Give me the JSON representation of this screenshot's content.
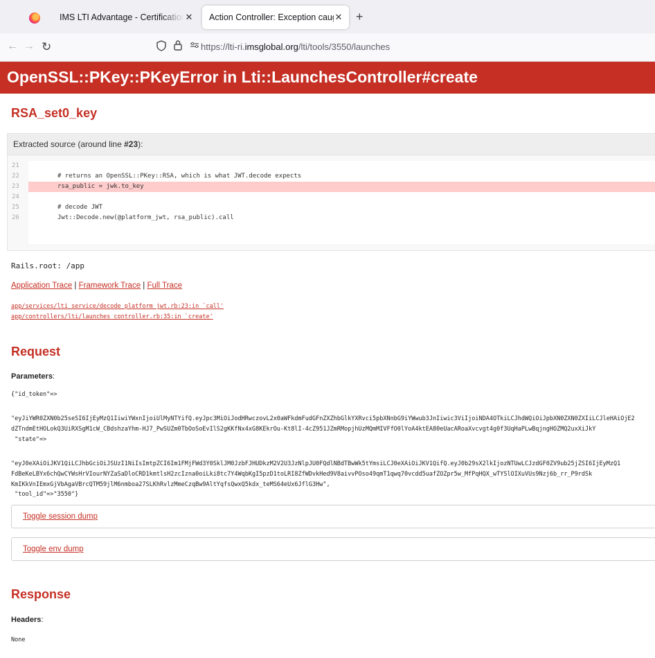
{
  "browser": {
    "tabs": [
      {
        "title": "IMS LTI Advantage - Certification Su",
        "active": false
      },
      {
        "title": "Action Controller: Exception caught",
        "active": true
      }
    ],
    "new_tab": "+",
    "url_prefix": "https://lti-ri.",
    "url_host": "imsglobal.org",
    "url_path": "/lti/tools/3550/launches"
  },
  "error": {
    "title": "OpenSSL::PKey::PKeyError in Lti::LaunchesController#create",
    "subtitle": "RSA_set0_key"
  },
  "source": {
    "header_prefix": "Extracted source (around line ",
    "header_line": "#23",
    "header_suffix": "):",
    "lines": [
      {
        "no": "21",
        "code": ""
      },
      {
        "no": "22",
        "code": "# returns an OpenSSL::PKey::RSA, which is what JWT.decode expects"
      },
      {
        "no": "23",
        "code": "rsa_public = jwk.to_key"
      },
      {
        "no": "24",
        "code": ""
      },
      {
        "no": "25",
        "code": "# decode JWT"
      },
      {
        "no": "26",
        "code": "Jwt::Decode.new(@platform_jwt, rsa_public).call"
      }
    ]
  },
  "rails_root": "Rails.root: /app",
  "traces": {
    "application": "Application Trace",
    "framework": "Framework Trace",
    "full": "Full Trace",
    "separator": "|",
    "lines": [
      "app/services/lti_service/decode_platform_jwt.rb:23:in `call'",
      "app/controllers/lti/launches_controller.rb:35:in `create'"
    ]
  },
  "request": {
    "heading": "Request",
    "params_label": "Parameters",
    "colon": ":",
    "params": [
      "{\"id_token\"=>",
      "\"eyJiYWR0ZXN0b25seSI6IjEyMzQ1IiwiYWxnIjoiUlMyNTYifQ.eyJpc3MiOiJodHRwczovL2x0aWFkdmFudGFnZXZhbGlkYXRvci5pbXNnbG9iYWwub3JnIiwic3ViIjoiNDA4OTkiLCJhdWQiOiJpbXN0ZXN0ZXIiLCJleHAiOjE2",
      "dZTndmEtHOLokQ3UiRXSgM1cW_CBdshzaYhm-HJ7_PwSUZm0TbOoSoEvIlS2gKKfNx4xG8KEkrOu-Kt8lI-4cZ951JZmRMopjhUzMQmMIVFfO0lYoA4ktEA80eUacARoaXvcvgt4g0f3UqHaPLwBqjngHOZMQ2uxXiJkY",
      " \"state\"=>",
      "\"eyJ0eXAiOiJKV1QiLCJhbGciOiJSUzI1NiIsImtpZCI6Im1FMjFWd3Y0SklJM0JzbFJHUDkzM2V2U3JzNlpJU0FQdlNBdTBwWk5tYmsiLCJ0eXAiOiJKV1QifQ.eyJ0b29sX2lkIjozNTUwLCJzdGF0ZV9ub25jZSI6IjEyMzQ1",
      "FdBeKeLBYx6chQwCYWsHrVIourNYZaSaDloCRD1kmtlsH2zcIzna0oiLki8tc7Y4WqbKgI5pzD1toLRI8ZfWDvkHed9V8aivvPOso49qmT1qwq70vcdd5uafZOZpr5w_MfPqHQX_wTYSlOIXuVUs9Nzj6b_rr_P9rdSk",
      "KmIKkVnIEmxGjVbAgaVBrcQTM59jlM6nmboa27SLKhRvlzMmeCzqBw9AltYqfsQwxQ5kdx_teMS64eUx6JflG3Hw\",",
      " \"tool_id\"=>\"3550\"}"
    ],
    "toggle_session": "Toggle session dump",
    "toggle_env": "Toggle env dump"
  },
  "response": {
    "heading": "Response",
    "headers_label": "Headers",
    "headers_value": "None"
  }
}
